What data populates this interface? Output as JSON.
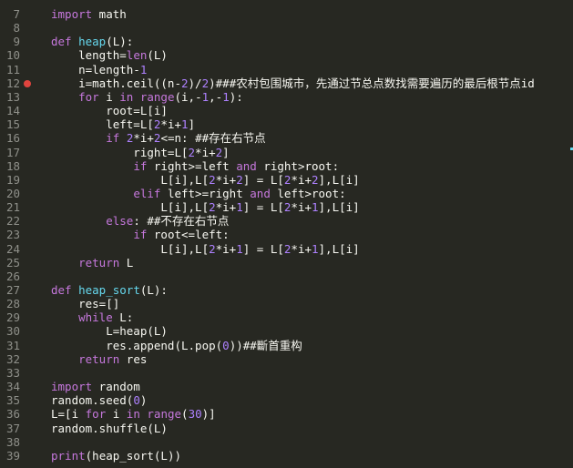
{
  "editor": {
    "breakpoint_color": "#e0443e",
    "lines": [
      {
        "n": "7",
        "segs": [
          {
            "t": "import",
            "c": "kw"
          },
          {
            "t": " math",
            "c": "plain"
          }
        ]
      },
      {
        "n": "8",
        "segs": []
      },
      {
        "n": "9",
        "segs": [
          {
            "t": "def ",
            "c": "kw"
          },
          {
            "t": "heap",
            "c": "fn"
          },
          {
            "t": "(L):",
            "c": "plain"
          }
        ]
      },
      {
        "n": "10",
        "segs": [
          {
            "t": "    length=",
            "c": "plain"
          },
          {
            "t": "len",
            "c": "kw"
          },
          {
            "t": "(L)",
            "c": "plain"
          }
        ]
      },
      {
        "n": "11",
        "segs": [
          {
            "t": "    n=length-",
            "c": "plain"
          },
          {
            "t": "1",
            "c": "num"
          }
        ]
      },
      {
        "n": "12",
        "bp": true,
        "segs": [
          {
            "t": "    i=math.ceil((n-",
            "c": "plain"
          },
          {
            "t": "2",
            "c": "num"
          },
          {
            "t": ")/",
            "c": "plain"
          },
          {
            "t": "2",
            "c": "num"
          },
          {
            "t": ")###农村包围城市，先通过节总点数找需要遍历的最后根节点id",
            "c": "plain"
          }
        ]
      },
      {
        "n": "13",
        "segs": [
          {
            "t": "    ",
            "c": "plain"
          },
          {
            "t": "for",
            "c": "kw"
          },
          {
            "t": " i ",
            "c": "plain"
          },
          {
            "t": "in",
            "c": "kw"
          },
          {
            "t": " ",
            "c": "plain"
          },
          {
            "t": "range",
            "c": "kw"
          },
          {
            "t": "(i,-",
            "c": "plain"
          },
          {
            "t": "1",
            "c": "num"
          },
          {
            "t": ",-",
            "c": "plain"
          },
          {
            "t": "1",
            "c": "num"
          },
          {
            "t": "):",
            "c": "plain"
          }
        ]
      },
      {
        "n": "14",
        "segs": [
          {
            "t": "        root=L[i]",
            "c": "plain"
          }
        ]
      },
      {
        "n": "15",
        "segs": [
          {
            "t": "        left=L[",
            "c": "plain"
          },
          {
            "t": "2",
            "c": "num"
          },
          {
            "t": "*i+",
            "c": "plain"
          },
          {
            "t": "1",
            "c": "num"
          },
          {
            "t": "]",
            "c": "plain"
          }
        ]
      },
      {
        "n": "16",
        "segs": [
          {
            "t": "        ",
            "c": "plain"
          },
          {
            "t": "if",
            "c": "kw"
          },
          {
            "t": " ",
            "c": "plain"
          },
          {
            "t": "2",
            "c": "num"
          },
          {
            "t": "*i+",
            "c": "plain"
          },
          {
            "t": "2",
            "c": "num"
          },
          {
            "t": "<=n: ##存在右节点",
            "c": "plain"
          }
        ]
      },
      {
        "n": "17",
        "segs": [
          {
            "t": "            right=L[",
            "c": "plain"
          },
          {
            "t": "2",
            "c": "num"
          },
          {
            "t": "*i+",
            "c": "plain"
          },
          {
            "t": "2",
            "c": "num"
          },
          {
            "t": "]",
            "c": "plain"
          }
        ]
      },
      {
        "n": "18",
        "segs": [
          {
            "t": "            ",
            "c": "plain"
          },
          {
            "t": "if",
            "c": "kw"
          },
          {
            "t": " right>=left ",
            "c": "plain"
          },
          {
            "t": "and",
            "c": "kw"
          },
          {
            "t": " right>root:",
            "c": "plain"
          }
        ]
      },
      {
        "n": "19",
        "segs": [
          {
            "t": "                L[i],L[",
            "c": "plain"
          },
          {
            "t": "2",
            "c": "num"
          },
          {
            "t": "*i+",
            "c": "plain"
          },
          {
            "t": "2",
            "c": "num"
          },
          {
            "t": "] = L[",
            "c": "plain"
          },
          {
            "t": "2",
            "c": "num"
          },
          {
            "t": "*i+",
            "c": "plain"
          },
          {
            "t": "2",
            "c": "num"
          },
          {
            "t": "],L[i]",
            "c": "plain"
          }
        ]
      },
      {
        "n": "20",
        "segs": [
          {
            "t": "            ",
            "c": "plain"
          },
          {
            "t": "elif",
            "c": "kw"
          },
          {
            "t": " left>=right ",
            "c": "plain"
          },
          {
            "t": "and",
            "c": "kw"
          },
          {
            "t": " left>root:",
            "c": "plain"
          }
        ]
      },
      {
        "n": "21",
        "segs": [
          {
            "t": "                L[i],L[",
            "c": "plain"
          },
          {
            "t": "2",
            "c": "num"
          },
          {
            "t": "*i+",
            "c": "plain"
          },
          {
            "t": "1",
            "c": "num"
          },
          {
            "t": "] = L[",
            "c": "plain"
          },
          {
            "t": "2",
            "c": "num"
          },
          {
            "t": "*i+",
            "c": "plain"
          },
          {
            "t": "1",
            "c": "num"
          },
          {
            "t": "],L[i]",
            "c": "plain"
          }
        ]
      },
      {
        "n": "22",
        "segs": [
          {
            "t": "        ",
            "c": "plain"
          },
          {
            "t": "else",
            "c": "kw"
          },
          {
            "t": ": ##不存在右节点",
            "c": "plain"
          }
        ]
      },
      {
        "n": "23",
        "segs": [
          {
            "t": "            ",
            "c": "plain"
          },
          {
            "t": "if",
            "c": "kw"
          },
          {
            "t": " root<=left:",
            "c": "plain"
          }
        ]
      },
      {
        "n": "24",
        "segs": [
          {
            "t": "                L[i],L[",
            "c": "plain"
          },
          {
            "t": "2",
            "c": "num"
          },
          {
            "t": "*i+",
            "c": "plain"
          },
          {
            "t": "1",
            "c": "num"
          },
          {
            "t": "] = L[",
            "c": "plain"
          },
          {
            "t": "2",
            "c": "num"
          },
          {
            "t": "*i+",
            "c": "plain"
          },
          {
            "t": "1",
            "c": "num"
          },
          {
            "t": "],L[i]",
            "c": "plain"
          }
        ]
      },
      {
        "n": "25",
        "segs": [
          {
            "t": "    ",
            "c": "plain"
          },
          {
            "t": "return",
            "c": "kw"
          },
          {
            "t": " L",
            "c": "plain"
          }
        ]
      },
      {
        "n": "26",
        "segs": []
      },
      {
        "n": "27",
        "segs": [
          {
            "t": "def ",
            "c": "kw"
          },
          {
            "t": "heap_sort",
            "c": "fn"
          },
          {
            "t": "(L):",
            "c": "plain"
          }
        ]
      },
      {
        "n": "28",
        "segs": [
          {
            "t": "    res=[]",
            "c": "plain"
          }
        ]
      },
      {
        "n": "29",
        "segs": [
          {
            "t": "    ",
            "c": "plain"
          },
          {
            "t": "while",
            "c": "kw"
          },
          {
            "t": " L:",
            "c": "plain"
          }
        ]
      },
      {
        "n": "30",
        "segs": [
          {
            "t": "        L=heap(L)",
            "c": "plain"
          }
        ]
      },
      {
        "n": "31",
        "segs": [
          {
            "t": "        res.append(L.pop(",
            "c": "plain"
          },
          {
            "t": "0",
            "c": "num"
          },
          {
            "t": "))##斷首重构",
            "c": "plain"
          }
        ]
      },
      {
        "n": "32",
        "segs": [
          {
            "t": "    ",
            "c": "plain"
          },
          {
            "t": "return",
            "c": "kw"
          },
          {
            "t": " res",
            "c": "plain"
          }
        ]
      },
      {
        "n": "33",
        "segs": []
      },
      {
        "n": "34",
        "segs": [
          {
            "t": "import",
            "c": "kw"
          },
          {
            "t": " random",
            "c": "plain"
          }
        ]
      },
      {
        "n": "35",
        "segs": [
          {
            "t": "random.seed(",
            "c": "plain"
          },
          {
            "t": "0",
            "c": "num"
          },
          {
            "t": ")",
            "c": "plain"
          }
        ]
      },
      {
        "n": "36",
        "segs": [
          {
            "t": "L=[i ",
            "c": "plain"
          },
          {
            "t": "for",
            "c": "kw"
          },
          {
            "t": " i ",
            "c": "plain"
          },
          {
            "t": "in",
            "c": "kw"
          },
          {
            "t": " ",
            "c": "plain"
          },
          {
            "t": "range",
            "c": "kw"
          },
          {
            "t": "(",
            "c": "plain"
          },
          {
            "t": "30",
            "c": "num"
          },
          {
            "t": ")]",
            "c": "plain"
          }
        ]
      },
      {
        "n": "37",
        "segs": [
          {
            "t": "random.shuffle(L)",
            "c": "plain"
          }
        ]
      },
      {
        "n": "38",
        "segs": []
      },
      {
        "n": "39",
        "segs": [
          {
            "t": "print",
            "c": "kw"
          },
          {
            "t": "(heap_sort(L))",
            "c": "plain"
          }
        ]
      }
    ]
  }
}
